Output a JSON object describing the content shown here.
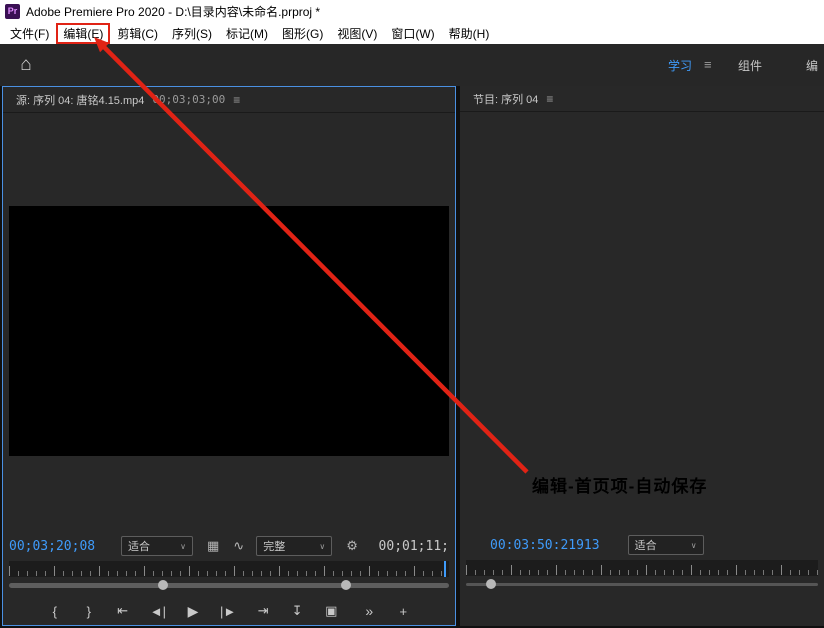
{
  "window": {
    "app_icon_text": "Pr",
    "title": "Adobe Premiere Pro 2020 - D:\\目录内容\\未命名.prproj *"
  },
  "menu_bar": {
    "items": [
      "文件(F)",
      "编辑(E)",
      "剪辑(C)",
      "序列(S)",
      "标记(M)",
      "图形(G)",
      "视图(V)",
      "窗口(W)",
      "帮助(H)"
    ],
    "highlighted_item": "编辑(E)"
  },
  "toolbar": {
    "workspace_learning": "学习",
    "workspace_components": "组件",
    "workspace_edit_clipped": "编"
  },
  "source_monitor": {
    "tab_label": "源: 序列 04: 唐铭4.15.mp4",
    "tab_timecode": "00;03;03;00",
    "position_timecode": "00;03;20;08",
    "zoom_value": "适合",
    "resolution_value": "完整",
    "duration_timecode": "00;01;11;"
  },
  "program_monitor": {
    "tab_label": "节目: 序列 04",
    "position_timecode": "00:03:50:21913",
    "zoom_value": "适合"
  },
  "annotation": {
    "label": "编辑-首页项-自动保存"
  },
  "icons": {
    "home": "⌂",
    "panel_menu": "≡",
    "chevron_down": "∨",
    "wrench": "⚙",
    "drag_video": "▦",
    "drag_audio": "∿",
    "mark_in": "{",
    "mark_out": "}",
    "go_to_in": "⇤",
    "step_back": "◄|",
    "play": "▶",
    "step_forward": "|►",
    "go_to_out": "⇥",
    "insert": "↧",
    "overwrite": "▣",
    "more": "»",
    "add": "+"
  },
  "colors": {
    "accent_blue": "#3f9bfa",
    "arrow_red": "#e02315"
  }
}
